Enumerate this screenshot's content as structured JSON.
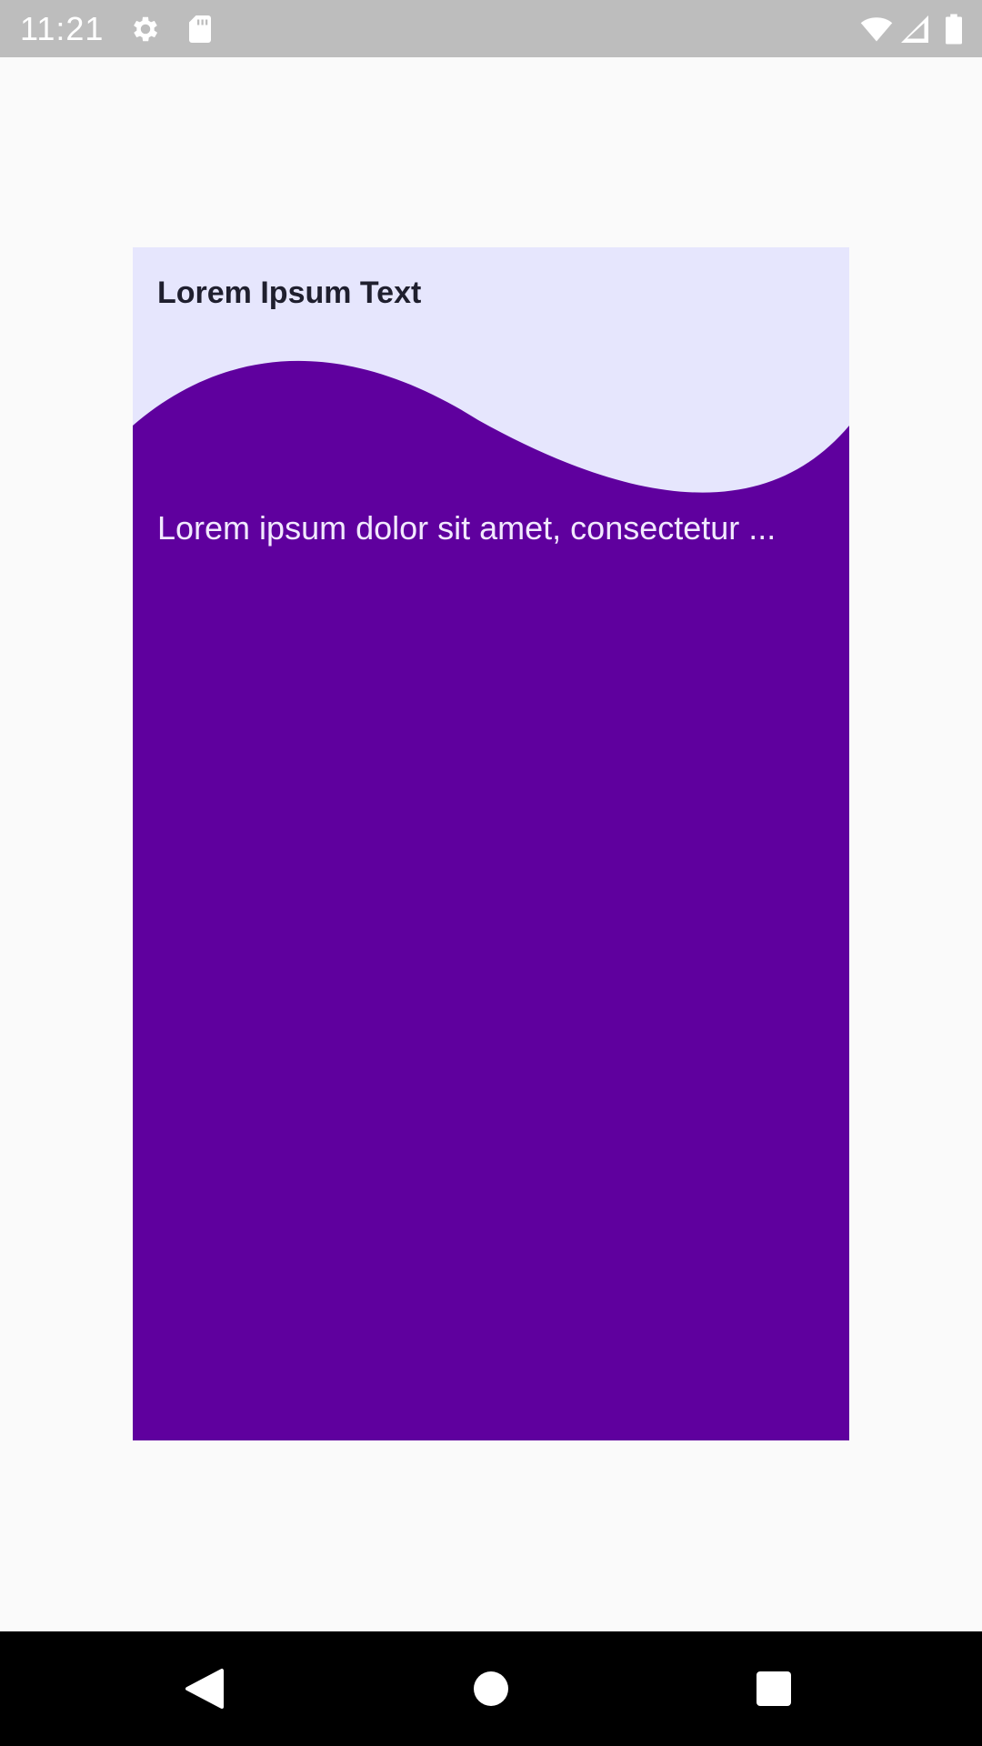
{
  "status_bar": {
    "time": "11:21",
    "icons": [
      "settings-icon",
      "sd-card-icon",
      "wifi-icon",
      "cellular-signal-icon",
      "battery-icon"
    ]
  },
  "card": {
    "title": "Lorem Ipsum Text",
    "body": "Lorem ipsum dolor sit amet, consectetur ...",
    "colors": {
      "top_background": "#e6e6fd",
      "wave_fill": "#5f009e",
      "title_color": "#1f1f2e",
      "body_color": "#f2e9ff"
    }
  },
  "nav_bar": {
    "buttons": [
      "back-icon",
      "home-icon",
      "recents-icon"
    ]
  }
}
